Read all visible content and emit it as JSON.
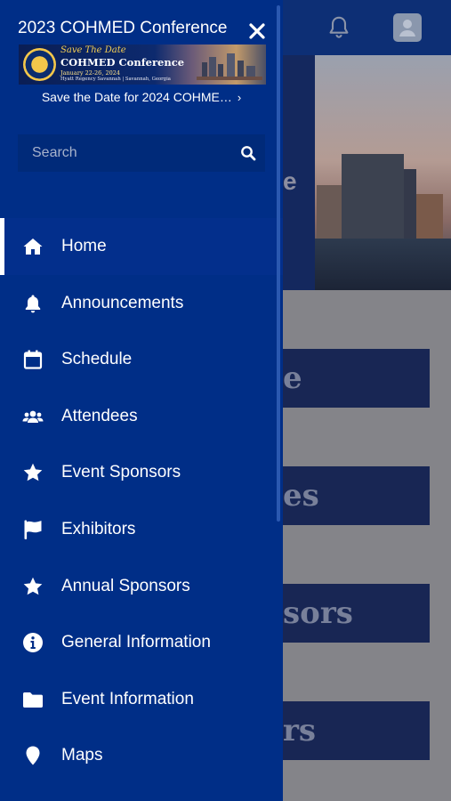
{
  "drawer": {
    "title": "2023 COHMED Conference",
    "banner": {
      "save_the_date": "Save The Date",
      "name": "COHMED Conference",
      "dates": "January 22-26, 2024",
      "venue": "Hyatt Regency Savannah  |  Savannah, Georgia"
    },
    "banner_link": "Save the Date for 2024 COHME…",
    "search": {
      "placeholder": "Search",
      "value": ""
    },
    "menu": [
      {
        "label": "Home",
        "icon": "home-icon",
        "active": true
      },
      {
        "label": "Announcements",
        "icon": "bell-icon"
      },
      {
        "label": "Schedule",
        "icon": "calendar-icon"
      },
      {
        "label": "Attendees",
        "icon": "users-icon"
      },
      {
        "label": "Event Sponsors",
        "icon": "star-icon"
      },
      {
        "label": "Exhibitors",
        "icon": "flag-icon"
      },
      {
        "label": "Annual Sponsors",
        "icon": "star-icon"
      },
      {
        "label": "General Information",
        "icon": "info-icon"
      },
      {
        "label": "Event Information",
        "icon": "folder-icon"
      },
      {
        "label": "Maps",
        "icon": "map-pin-icon"
      }
    ]
  },
  "background": {
    "hero_fragment": "e",
    "tiles": [
      "e",
      "es",
      "sors",
      "rs"
    ]
  },
  "colors": {
    "drawer": "#002e87",
    "header": "#0d2f75",
    "tile": "#182654"
  }
}
